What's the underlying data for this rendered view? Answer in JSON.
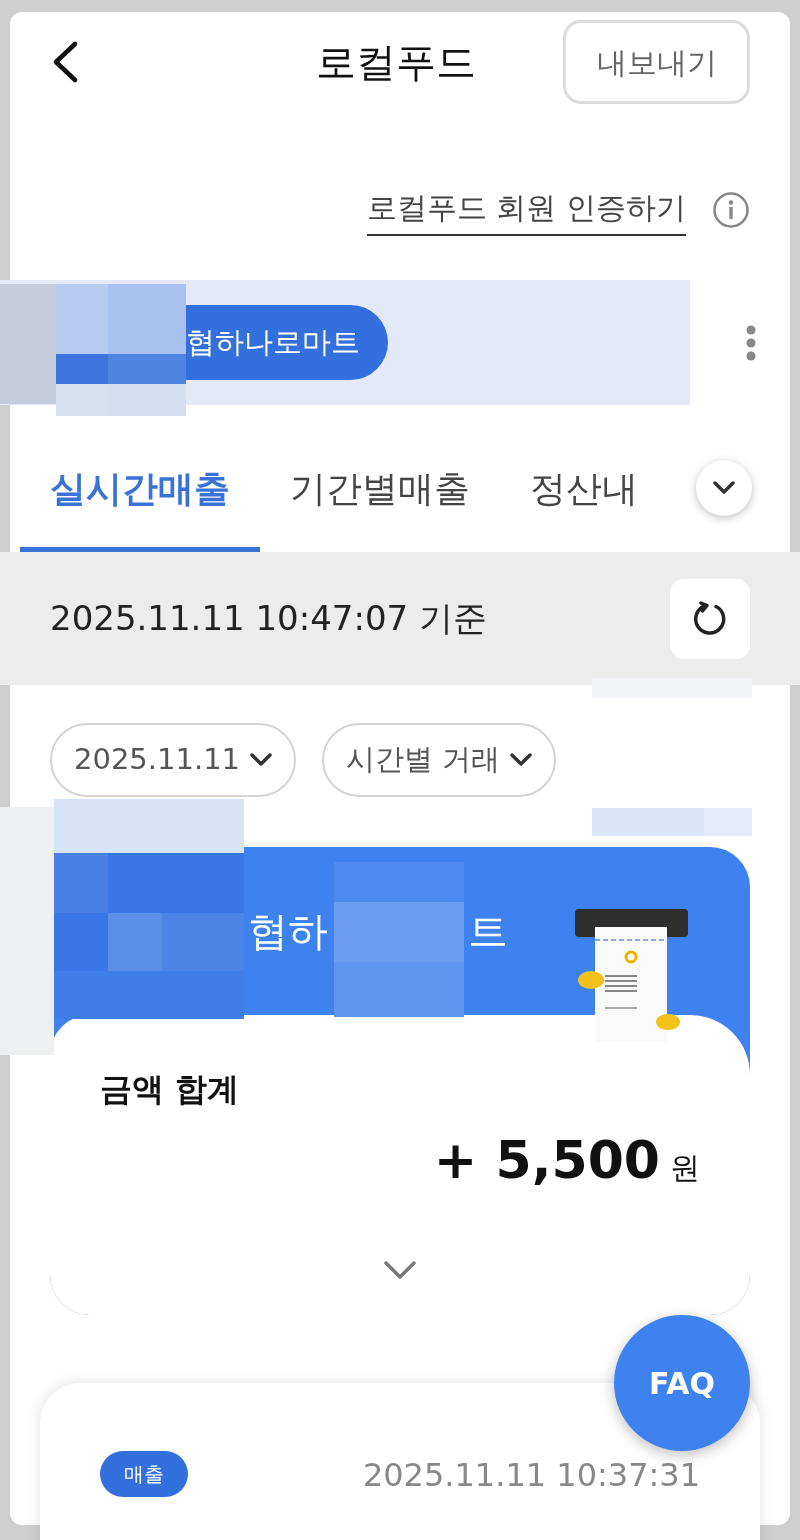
{
  "header": {
    "title": "로컬푸드",
    "export_button": "내보내기"
  },
  "member_link": "로컬푸드 회원 인증하기",
  "store": {
    "name": "협하나로마트"
  },
  "tabs": [
    {
      "label": "실시간매출",
      "selected": true
    },
    {
      "label": "기간별매출",
      "selected": false
    },
    {
      "label": "정산내",
      "selected": false
    }
  ],
  "timestamp": "2025.11.11 10:47:07 기준",
  "filters": [
    {
      "label": "2025.11.11"
    },
    {
      "label": "시간별 거래"
    }
  ],
  "summary": {
    "title_parts": [
      "협하",
      "트"
    ],
    "total_label": "금액 합계",
    "total_amount": "+ 5,500",
    "currency": "원"
  },
  "faq_button": "FAQ",
  "transactions": [
    {
      "type_badge": "매출",
      "time": "2025.11.11 10:37:31"
    }
  ]
}
